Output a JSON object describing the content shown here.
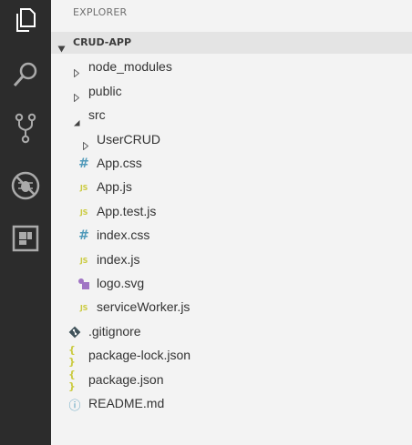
{
  "activity_bar": {
    "items": [
      {
        "name": "explorer",
        "icon": "files-icon",
        "active": true
      },
      {
        "name": "search",
        "icon": "search-icon",
        "active": false
      },
      {
        "name": "source-control",
        "icon": "source-control-icon",
        "active": false
      },
      {
        "name": "debug",
        "icon": "debug-icon",
        "active": false
      },
      {
        "name": "extensions",
        "icon": "extensions-icon",
        "active": false
      }
    ]
  },
  "explorer": {
    "title": "EXPLORER",
    "project": {
      "name": "CRUD-APP",
      "expanded": true
    },
    "tree": [
      {
        "label": "node_modules",
        "kind": "folder",
        "expanded": false
      },
      {
        "label": "public",
        "kind": "folder",
        "expanded": false
      },
      {
        "label": "src",
        "kind": "folder",
        "expanded": true
      },
      {
        "label": "UserCRUD",
        "kind": "folder",
        "expanded": false
      },
      {
        "label": "App.css",
        "kind": "css",
        "icon": "css-file-icon"
      },
      {
        "label": "App.js",
        "kind": "js",
        "icon": "js-file-icon"
      },
      {
        "label": "App.test.js",
        "kind": "js",
        "icon": "js-file-icon"
      },
      {
        "label": "index.css",
        "kind": "css",
        "icon": "css-file-icon"
      },
      {
        "label": "index.js",
        "kind": "js",
        "icon": "js-file-icon"
      },
      {
        "label": "logo.svg",
        "kind": "svg",
        "icon": "svg-file-icon"
      },
      {
        "label": "serviceWorker.js",
        "kind": "js",
        "icon": "js-file-icon"
      },
      {
        "label": ".gitignore",
        "kind": "git",
        "icon": "git-file-icon"
      },
      {
        "label": "package-lock.json",
        "kind": "json",
        "icon": "json-file-icon"
      },
      {
        "label": "package.json",
        "kind": "json",
        "icon": "json-file-icon"
      },
      {
        "label": "README.md",
        "kind": "info",
        "icon": "info-file-icon"
      }
    ],
    "icon_text": {
      "css": "#",
      "js": "JS",
      "json": "{ }",
      "info": "ⓘ"
    },
    "colors": {
      "css": "#519aba",
      "js": "#cbcb41",
      "json": "#cbcb41",
      "svg": "#a074c4",
      "git": "#41535b",
      "info": "#519aba"
    }
  }
}
